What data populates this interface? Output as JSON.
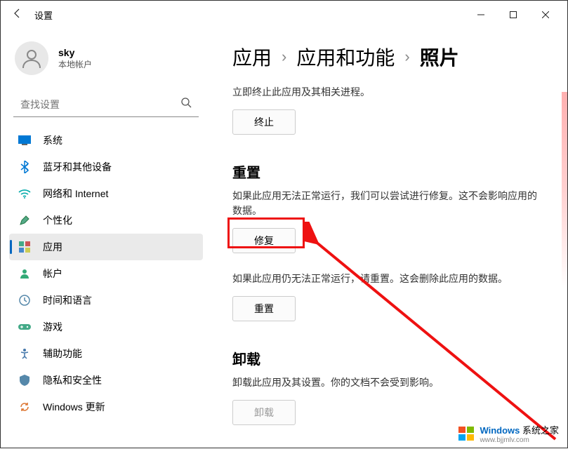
{
  "window": {
    "title": "设置"
  },
  "user": {
    "name": "sky",
    "account_type": "本地帐户"
  },
  "search": {
    "placeholder": "查找设置"
  },
  "sidebar": {
    "items": [
      {
        "label": "系统",
        "icon": "system"
      },
      {
        "label": "蓝牙和其他设备",
        "icon": "bluetooth"
      },
      {
        "label": "网络和 Internet",
        "icon": "network"
      },
      {
        "label": "个性化",
        "icon": "personalize"
      },
      {
        "label": "应用",
        "icon": "apps",
        "selected": true
      },
      {
        "label": "帐户",
        "icon": "accounts"
      },
      {
        "label": "时间和语言",
        "icon": "time"
      },
      {
        "label": "游戏",
        "icon": "gaming"
      },
      {
        "label": "辅助功能",
        "icon": "accessibility"
      },
      {
        "label": "隐私和安全性",
        "icon": "privacy"
      },
      {
        "label": "Windows 更新",
        "icon": "update"
      }
    ]
  },
  "breadcrumb": {
    "root": "应用",
    "mid": "应用和功能",
    "current": "照片"
  },
  "terminate": {
    "desc": "立即终止此应用及其相关进程。",
    "button": "终止"
  },
  "reset": {
    "title": "重置",
    "repair_desc": "如果此应用无法正常运行，我们可以尝试进行修复。这不会影响应用的数据。",
    "repair_button": "修复",
    "reset_desc": "如果此应用仍无法正常运行，请重置。这会删除此应用的数据。",
    "reset_button": "重置"
  },
  "uninstall": {
    "title": "卸载",
    "desc": "卸载此应用及其设置。你的文档不会受到影响。",
    "button": "卸载"
  },
  "watermark": {
    "brand": "Windows",
    "suffix": " 系统之家",
    "url": "www.bjjmlv.com"
  }
}
